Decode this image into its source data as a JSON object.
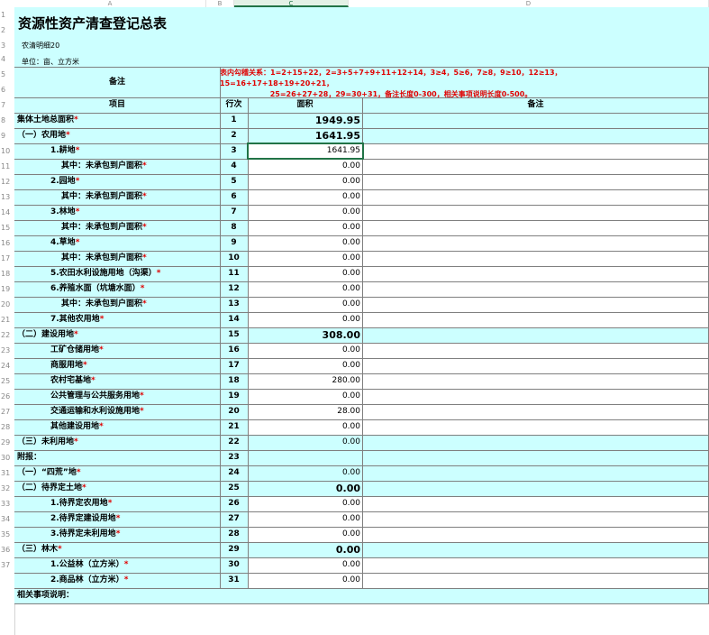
{
  "colors": {
    "fill": "#ccffff",
    "required": "#e00000",
    "selection": "#217346"
  },
  "column_headers": [
    "A",
    "B",
    "C",
    "D"
  ],
  "row_numbers": [
    "1",
    "2",
    "3",
    "4",
    "5",
    "6",
    "7",
    "8",
    "9",
    "10",
    "11",
    "12",
    "13",
    "14",
    "15",
    "16",
    "17",
    "18",
    "19",
    "20",
    "21",
    "22",
    "23",
    "24",
    "25",
    "26",
    "27",
    "28",
    "29",
    "30",
    "31",
    "32",
    "33",
    "34",
    "35",
    "36",
    "37"
  ],
  "title": "资源性资产清查登记总表",
  "subtitle": "农清明细20",
  "unit": "单位：亩、立方米",
  "note_header": "备注",
  "rules_text": "表内勾稽关系：1=2+15+22，2=3+5+7+9+11+12+14，3≥4，5≥6，7≥8，9≥10，12≥13，\n15=16+17+18+19+20+21，\n                    25=26+27+28，29=30+31，备注长度0-300，相关事项说明长度0-500。",
  "headers": {
    "item": "项目",
    "seq": "行次",
    "area": "面积",
    "remark": "备注"
  },
  "rows": [
    {
      "label": "集体土地总面积",
      "seq": "1",
      "area": "1949.95",
      "req": "*"
    },
    {
      "label": "（一）农用地",
      "seq": "2",
      "area": "1641.95",
      "req": "*"
    },
    {
      "label": "1.耕地",
      "seq": "3",
      "area": "1641.95",
      "req": "*"
    },
    {
      "label": "其中：未承包到户面积",
      "seq": "4",
      "area": "0.00",
      "req": "*"
    },
    {
      "label": "2.园地",
      "seq": "5",
      "area": "0.00",
      "req": "*"
    },
    {
      "label": "其中：未承包到户面积",
      "seq": "6",
      "area": "0.00",
      "req": "*"
    },
    {
      "label": "3.林地",
      "seq": "7",
      "area": "0.00",
      "req": "*"
    },
    {
      "label": "其中：未承包到户面积",
      "seq": "8",
      "area": "0.00",
      "req": "*"
    },
    {
      "label": "4.草地",
      "seq": "9",
      "area": "0.00",
      "req": "*"
    },
    {
      "label": "其中：未承包到户面积",
      "seq": "10",
      "area": "0.00",
      "req": "*"
    },
    {
      "label": "5.农田水利设施用地（沟渠）",
      "seq": "11",
      "area": "0.00",
      "req": "*"
    },
    {
      "label": "6.养殖水面（坑塘水面）",
      "seq": "12",
      "area": "0.00",
      "req": "*"
    },
    {
      "label": "其中：未承包到户面积",
      "seq": "13",
      "area": "0.00",
      "req": "*"
    },
    {
      "label": "7.其他农用地",
      "seq": "14",
      "area": "0.00",
      "req": "*"
    },
    {
      "label": "（二）建设用地",
      "seq": "15",
      "area": "308.00",
      "req": "*"
    },
    {
      "label": "工矿仓储用地",
      "seq": "16",
      "area": "0.00",
      "req": "*"
    },
    {
      "label": "商服用地",
      "seq": "17",
      "area": "0.00",
      "req": "*"
    },
    {
      "label": "农村宅基地",
      "seq": "18",
      "area": "280.00",
      "req": "*"
    },
    {
      "label": "公共管理与公共服务用地",
      "seq": "19",
      "area": "0.00",
      "req": "*"
    },
    {
      "label": "交通运输和水利设施用地",
      "seq": "20",
      "area": "28.00",
      "req": "*"
    },
    {
      "label": "其他建设用地",
      "seq": "21",
      "area": "0.00",
      "req": "*"
    },
    {
      "label": "（三）未利用地",
      "seq": "22",
      "area": "0.00",
      "req": "*"
    },
    {
      "label": "附报：",
      "seq": "23",
      "area": "",
      "req": ""
    },
    {
      "label": "（一）“四荒”地",
      "seq": "24",
      "area": "0.00",
      "req": "*"
    },
    {
      "label": "（二）待界定土地",
      "seq": "25",
      "area": "0.00",
      "req": "*"
    },
    {
      "label": "1.待界定农用地",
      "seq": "26",
      "area": "0.00",
      "req": "*"
    },
    {
      "label": "2.待界定建设用地",
      "seq": "27",
      "area": "0.00",
      "req": "*"
    },
    {
      "label": "3.待界定未利用地",
      "seq": "28",
      "area": "0.00",
      "req": "*"
    },
    {
      "label": "（三）林木",
      "seq": "29",
      "area": "0.00",
      "req": "*"
    },
    {
      "label": "1.公益林（立方米）",
      "seq": "30",
      "area": "0.00",
      "req": "*"
    },
    {
      "label": "2.商品林（立方米）",
      "seq": "31",
      "area": "0.00",
      "req": "*"
    }
  ],
  "footer": "相关事项说明："
}
